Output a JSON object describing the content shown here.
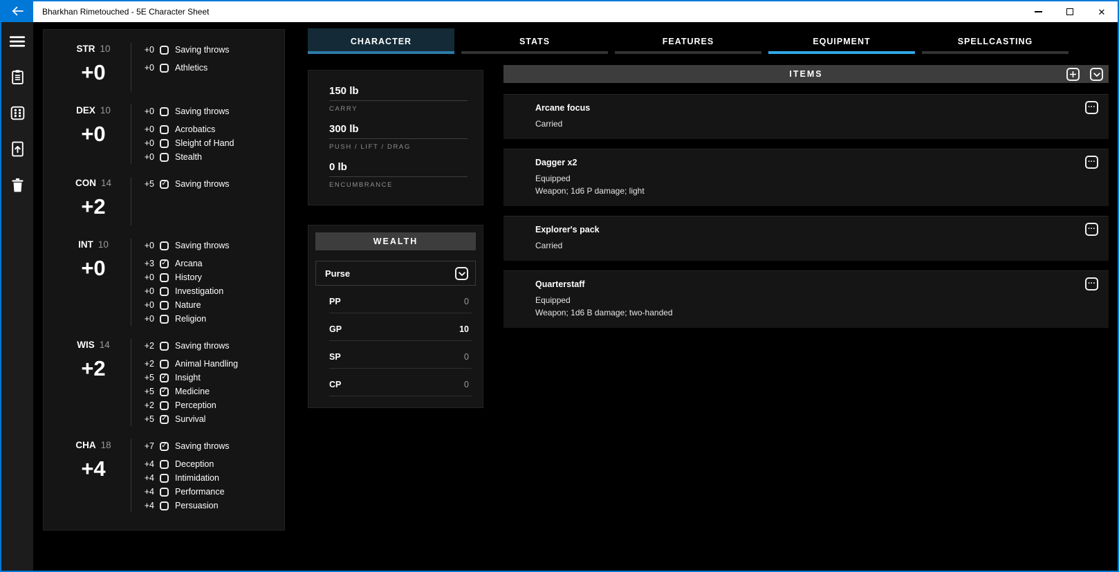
{
  "colors": {
    "accent": "#0078d7",
    "panel": "#151515",
    "bar": "#3d3d3d",
    "tab_focus_bg": "#142b37",
    "tab_focus_underline": "#2d7ba8",
    "tab_selected_underline": "#2fa9e6"
  },
  "window": {
    "title": "Bharkhan Rimetouched - 5E Character Sheet",
    "controls": [
      "back-arrow",
      "minimize",
      "maximize",
      "close"
    ]
  },
  "sidebar": {
    "icons": [
      "menu",
      "clipboard",
      "dice",
      "file-export",
      "trash"
    ]
  },
  "abilities": [
    {
      "name": "STR",
      "score": "10",
      "modifier": "+0",
      "saving": {
        "label": "Saving throws",
        "value": "+0",
        "proficient": false
      },
      "skills": [
        {
          "label": "Athletics",
          "value": "+0",
          "proficient": false
        }
      ]
    },
    {
      "name": "DEX",
      "score": "10",
      "modifier": "+0",
      "saving": {
        "label": "Saving throws",
        "value": "+0",
        "proficient": false
      },
      "skills": [
        {
          "label": "Acrobatics",
          "value": "+0",
          "proficient": false
        },
        {
          "label": "Sleight of Hand",
          "value": "+0",
          "proficient": false
        },
        {
          "label": "Stealth",
          "value": "+0",
          "proficient": false
        }
      ]
    },
    {
      "name": "CON",
      "score": "14",
      "modifier": "+2",
      "saving": {
        "label": "Saving throws",
        "value": "+5",
        "proficient": true
      },
      "skills": []
    },
    {
      "name": "INT",
      "score": "10",
      "modifier": "+0",
      "saving": {
        "label": "Saving throws",
        "value": "+0",
        "proficient": false
      },
      "skills": [
        {
          "label": "Arcana",
          "value": "+3",
          "proficient": true
        },
        {
          "label": "History",
          "value": "+0",
          "proficient": false
        },
        {
          "label": "Investigation",
          "value": "+0",
          "proficient": false
        },
        {
          "label": "Nature",
          "value": "+0",
          "proficient": false
        },
        {
          "label": "Religion",
          "value": "+0",
          "proficient": false
        }
      ]
    },
    {
      "name": "WIS",
      "score": "14",
      "modifier": "+2",
      "saving": {
        "label": "Saving throws",
        "value": "+2",
        "proficient": false
      },
      "skills": [
        {
          "label": "Animal Handling",
          "value": "+2",
          "proficient": false
        },
        {
          "label": "Insight",
          "value": "+5",
          "proficient": true
        },
        {
          "label": "Medicine",
          "value": "+5",
          "proficient": true
        },
        {
          "label": "Perception",
          "value": "+2",
          "proficient": false
        },
        {
          "label": "Survival",
          "value": "+5",
          "proficient": true
        }
      ]
    },
    {
      "name": "CHA",
      "score": "18",
      "modifier": "+4",
      "saving": {
        "label": "Saving throws",
        "value": "+7",
        "proficient": true
      },
      "skills": [
        {
          "label": "Deception",
          "value": "+4",
          "proficient": false
        },
        {
          "label": "Intimidation",
          "value": "+4",
          "proficient": false
        },
        {
          "label": "Performance",
          "value": "+4",
          "proficient": false
        },
        {
          "label": "Persuasion",
          "value": "+4",
          "proficient": false
        }
      ]
    }
  ],
  "tabs": [
    {
      "label": "CHARACTER",
      "focused": true,
      "selected": false
    },
    {
      "label": "STATS",
      "focused": false,
      "selected": false
    },
    {
      "label": "FEATURES",
      "focused": false,
      "selected": false
    },
    {
      "label": "EQUIPMENT",
      "focused": false,
      "selected": true
    },
    {
      "label": "SPELLCASTING",
      "focused": false,
      "selected": false
    }
  ],
  "encumbrance": [
    {
      "value": "150 lb",
      "label": "CARRY"
    },
    {
      "value": "300 lb",
      "label": "PUSH / LIFT / DRAG"
    },
    {
      "value": "0 lb",
      "label": "ENCUMBRANCE"
    }
  ],
  "wealth": {
    "title": "WEALTH",
    "purse_label": "Purse",
    "coins": [
      {
        "label": "PP",
        "value": "0",
        "highlight": false
      },
      {
        "label": "GP",
        "value": "10",
        "highlight": true
      },
      {
        "label": "SP",
        "value": "0",
        "highlight": false
      },
      {
        "label": "CP",
        "value": "0",
        "highlight": false
      }
    ]
  },
  "items": {
    "title": "ITEMS",
    "entries": [
      {
        "name": "Arcane focus",
        "status": "Carried",
        "details": ""
      },
      {
        "name": "Dagger x2",
        "status": "Equipped",
        "details": "Weapon; 1d6 P damage; light"
      },
      {
        "name": "Explorer's pack",
        "status": "Carried",
        "details": ""
      },
      {
        "name": "Quarterstaff",
        "status": "Equipped",
        "details": "Weapon; 1d6 B damage; two-handed"
      }
    ]
  }
}
